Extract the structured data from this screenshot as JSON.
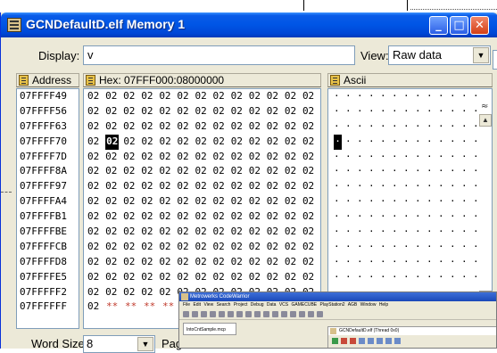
{
  "window": {
    "title": "GCNDefaultD.elf Memory 1",
    "min_label": "_",
    "max_label": "□",
    "close_label": "✕"
  },
  "display": {
    "label": "Display:",
    "value": "v"
  },
  "view": {
    "label": "View:",
    "value": "Raw data",
    "arrow": "▼"
  },
  "columns": {
    "address": "Address",
    "hex": "Hex: 07FFF000:08000000",
    "ascii": "Ascii"
  },
  "addresses": [
    "07FFFF49",
    "07FFFF56",
    "07FFFF63",
    "07FFFF70",
    "07FFFF7D",
    "07FFFF8A",
    "07FFFF97",
    "07FFFFA4",
    "07FFFFB1",
    "07FFFFBE",
    "07FFFFCB",
    "07FFFFD8",
    "07FFFFE5",
    "07FFFFF2",
    "07FFFFFF"
  ],
  "hex_rows": [
    [
      "02",
      "02",
      "02",
      "02",
      "02",
      "02",
      "02",
      "02",
      "02",
      "02",
      "02",
      "02",
      "02"
    ],
    [
      "02",
      "02",
      "02",
      "02",
      "02",
      "02",
      "02",
      "02",
      "02",
      "02",
      "02",
      "02",
      "02"
    ],
    [
      "02",
      "02",
      "02",
      "02",
      "02",
      "02",
      "02",
      "02",
      "02",
      "02",
      "02",
      "02",
      "02"
    ],
    [
      "02",
      "02",
      "02",
      "02",
      "02",
      "02",
      "02",
      "02",
      "02",
      "02",
      "02",
      "02",
      "02"
    ],
    [
      "02",
      "02",
      "02",
      "02",
      "02",
      "02",
      "02",
      "02",
      "02",
      "02",
      "02",
      "02",
      "02"
    ],
    [
      "02",
      "02",
      "02",
      "02",
      "02",
      "02",
      "02",
      "02",
      "02",
      "02",
      "02",
      "02",
      "02"
    ],
    [
      "02",
      "02",
      "02",
      "02",
      "02",
      "02",
      "02",
      "02",
      "02",
      "02",
      "02",
      "02",
      "02"
    ],
    [
      "02",
      "02",
      "02",
      "02",
      "02",
      "02",
      "02",
      "02",
      "02",
      "02",
      "02",
      "02",
      "02"
    ],
    [
      "02",
      "02",
      "02",
      "02",
      "02",
      "02",
      "02",
      "02",
      "02",
      "02",
      "02",
      "02",
      "02"
    ],
    [
      "02",
      "02",
      "02",
      "02",
      "02",
      "02",
      "02",
      "02",
      "02",
      "02",
      "02",
      "02",
      "02"
    ],
    [
      "02",
      "02",
      "02",
      "02",
      "02",
      "02",
      "02",
      "02",
      "02",
      "02",
      "02",
      "02",
      "02"
    ],
    [
      "02",
      "02",
      "02",
      "02",
      "02",
      "02",
      "02",
      "02",
      "02",
      "02",
      "02",
      "02",
      "02"
    ],
    [
      "02",
      "02",
      "02",
      "02",
      "02",
      "02",
      "02",
      "02",
      "02",
      "02",
      "02",
      "02",
      "02"
    ],
    [
      "02",
      "02",
      "02",
      "02",
      "02",
      "02",
      "02",
      "02",
      "02",
      "02",
      "02",
      "02",
      "02"
    ],
    [
      "02",
      "**",
      "**",
      "**",
      "**"
    ]
  ],
  "ascii_rows": [
    [
      "·",
      "·",
      "·",
      "·",
      "·",
      "·",
      "·",
      "·",
      "·",
      "·",
      "·",
      "·",
      "·"
    ],
    [
      "·",
      "·",
      "·",
      "·",
      "·",
      "·",
      "·",
      "·",
      "·",
      "·",
      "·",
      "·",
      "·"
    ],
    [
      "·",
      "·",
      "·",
      "·",
      "·",
      "·",
      "·",
      "·",
      "·",
      "·",
      "·",
      "·",
      "·"
    ],
    [
      "·",
      "·",
      "·",
      "·",
      "·",
      "·",
      "·",
      "·",
      "·",
      "·",
      "·",
      "·",
      "·"
    ],
    [
      "·",
      "·",
      "·",
      "·",
      "·",
      "·",
      "·",
      "·",
      "·",
      "·",
      "·",
      "·",
      "·"
    ],
    [
      "·",
      "·",
      "·",
      "·",
      "·",
      "·",
      "·",
      "·",
      "·",
      "·",
      "·",
      "·",
      "·"
    ],
    [
      "·",
      "·",
      "·",
      "·",
      "·",
      "·",
      "·",
      "·",
      "·",
      "·",
      "·",
      "·",
      "·"
    ],
    [
      "·",
      "·",
      "·",
      "·",
      "·",
      "·",
      "·",
      "·",
      "·",
      "·",
      "·",
      "·",
      "·"
    ],
    [
      "·",
      "·",
      "·",
      "·",
      "·",
      "·",
      "·",
      "·",
      "·",
      "·",
      "·",
      "·",
      "·"
    ],
    [
      "·",
      "·",
      "·",
      "·",
      "·",
      "·",
      "·",
      "·",
      "·",
      "·",
      "·",
      "·",
      "·"
    ],
    [
      "·",
      "·",
      "·",
      "·",
      "·",
      "·",
      "·",
      "·",
      "·",
      "·",
      "·",
      "·",
      "·"
    ],
    [
      "·",
      "·",
      "·",
      "·",
      "·",
      "·",
      "·",
      "·",
      "·",
      "·",
      "·",
      "·",
      "·"
    ],
    [
      "·",
      "·",
      "·",
      "·",
      "·",
      "·",
      "·",
      "·",
      "·",
      "·",
      "·",
      "·",
      "·"
    ]
  ],
  "selection": {
    "row": 3,
    "col": 1
  },
  "scroll": {
    "up2": "≈",
    "up": "▲"
  },
  "word_size": {
    "label": "Word Size:",
    "value": "8",
    "arrow": "▼"
  },
  "page": {
    "label": "Pag"
  },
  "codewarrior": {
    "title": "Metrowerks CodeWarrior",
    "menu": "File Edit View Search Project Debug Data VCS GAMECUBE PlayStation2 AGB Window Help",
    "tab": "IntoCntSample.mcp",
    "sub_title": "GCNDefaultD.elf (Thread 0x0)"
  }
}
